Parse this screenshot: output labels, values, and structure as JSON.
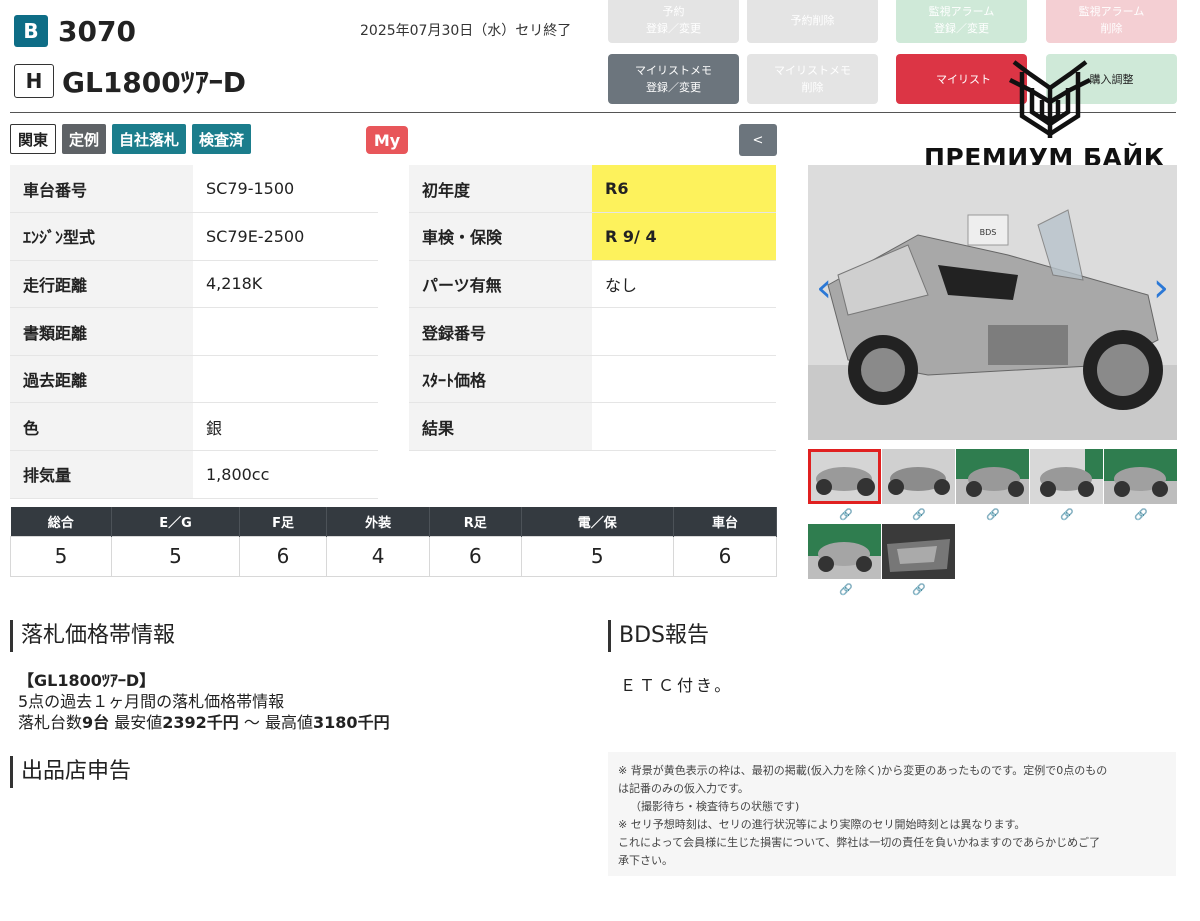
{
  "header": {
    "auction_badge": "B",
    "lot_number": "3070",
    "auction_date": "2025年07月30日（水）セリ終了",
    "rank_badge": "H",
    "model_name": "GL1800ﾂｱｰD"
  },
  "buttons": {
    "reserve_register": "予約\n登録／変更",
    "reserve_delete": "予約削除",
    "alarm_register": "監視アラーム\n登録／変更",
    "alarm_delete": "監視アラーム\n削除",
    "mylist_memo_register": "マイリストメモ\n登録／変更",
    "mylist_memo_delete": "マイリストメモ\n削除",
    "mylist": "マイリスト",
    "buy_adjust": "購入調整",
    "back": "<"
  },
  "logo": {
    "text": "ПРЕМИУМ БАЙК"
  },
  "tags": [
    "関東",
    "定例",
    "自社落札",
    "検査済"
  ],
  "my_badge": "My",
  "specs_left": [
    {
      "label": "車台番号",
      "value": "SC79-1500"
    },
    {
      "label": "ｴﾝｼﾞﾝ型式",
      "value": "SC79E-2500"
    },
    {
      "label": "走行距離",
      "value": "4,218K"
    },
    {
      "label": "書類距離",
      "value": ""
    },
    {
      "label": "過去距離",
      "value": ""
    },
    {
      "label": "色",
      "value": "銀"
    },
    {
      "label": "排気量",
      "value": "1,800cc"
    }
  ],
  "specs_right": [
    {
      "label": "初年度",
      "value": "R6",
      "highlight": true
    },
    {
      "label": "車検・保険",
      "value": "R 9/ 4",
      "highlight": true
    },
    {
      "label": "パーツ有無",
      "value": "なし",
      "highlight": false
    },
    {
      "label": "登録番号",
      "value": "",
      "highlight": false
    },
    {
      "label": "ｽﾀｰﾄ価格",
      "value": "",
      "highlight": false
    },
    {
      "label": "結果",
      "value": "",
      "highlight": false
    }
  ],
  "scores": {
    "headers": [
      "総合",
      "E／G",
      "F足",
      "外装",
      "R足",
      "電／保",
      "車台"
    ],
    "values": [
      "5",
      "5",
      "6",
      "4",
      "6",
      "5",
      "6"
    ]
  },
  "sections": {
    "price_title": "落札価格帯情報",
    "price_model": "【GL1800ﾂｱｰD】",
    "price_line1": "5点の過去１ヶ月間の落札価格帯情報",
    "price_line2_prefix": "落札台数",
    "price_count": "9台",
    "price_min_label": "最安値",
    "price_min": "2392千円",
    "price_sep": "〜",
    "price_max_label": "最高値",
    "price_max": "3180千円",
    "seller_title": "出品店申告",
    "bds_title": "BDS報告",
    "bds_text": "ＥＴＣ付き。"
  },
  "notes": [
    "※ 背景が黄色表示の枠は、最初の掲載(仮入力を除く)から変更のあったものです。定例で0点のもの",
    "は記番のみの仮入力です。",
    "（撮影待ち・検査待ちの状態です)",
    "※ セリ予想時刻は、セリの進行状況等により実際のセリ開始時刻とは異なります。",
    "これによって会員様に生じた損害について、弊社は一切の責任を負いかねますのであらかじめご了",
    "承下さい。"
  ]
}
